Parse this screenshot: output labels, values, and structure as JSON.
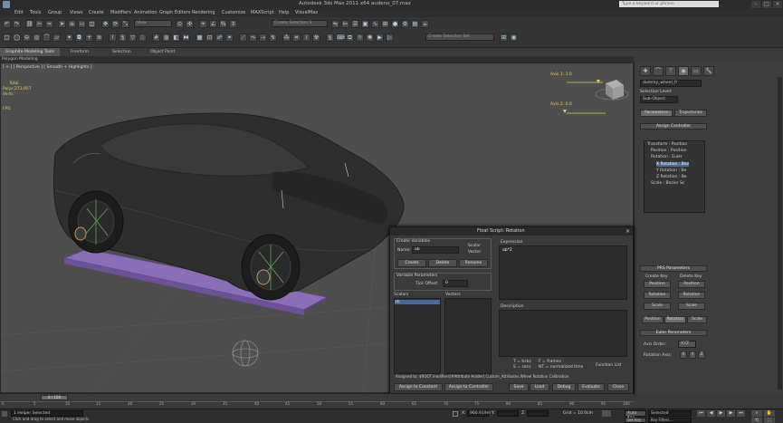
{
  "app": {
    "title": "Autodesk 3ds Max 2011 x64    audeno_07.max",
    "search_placeholder": "Type a keyword or phrase"
  },
  "menu": [
    "Edit",
    "Tools",
    "Group",
    "Views",
    "Create",
    "Modifiers",
    "Animation",
    "Graph Editors",
    "Rendering",
    "Customize",
    "MAXScript",
    "Help",
    "VisualMax"
  ],
  "toolbar": {
    "selection_filter": "Create Selection S",
    "named_selection": "Create Selection Set",
    "view_dropdown": "View"
  },
  "ribbon": {
    "tabs": [
      "Graphite Modeling Tools",
      "Freeform",
      "Selection",
      "Object Paint"
    ],
    "sub_label": "Polygon Modeling"
  },
  "viewport": {
    "label": "[ + ] [ Perspective ] [ Smooth + Highlights ]",
    "stats_header": "Total",
    "polys_label": "Polys:",
    "polys_value": "273,957",
    "verts_label": "Verts:",
    "verts_value": "",
    "fps_label": "FPS:",
    "fps_value": "",
    "axis_top_label": "Axis 1: 1.0",
    "axis_bottom_label": "Axis 2: 0.0"
  },
  "command_panel": {
    "object_name": "dummy_wheel_fr",
    "selection_level_label": "Selection Level:",
    "selection_level_value": "Sub-Object",
    "tab_parameters": "Parameters",
    "tab_trajectories": "Trajectories",
    "assign_controller_rollout": "Assign Controller",
    "tree": [
      "Transform : Position",
      "Position : Position",
      "Rotation : Euler",
      "X Rotation : Bez",
      "Y Rotation : Be",
      "Z Rotation : Be",
      "Scale : Bezier Sc"
    ],
    "pri_rollout": "PRS Parameters",
    "create_key_label": "Create Key",
    "delete_key_label": "Delete Key",
    "btn_position": "Position",
    "btn_rotation": "Rotation",
    "btn_scale": "Scale",
    "tab_position": "Position",
    "tab_rotation": "Rotation",
    "tab_scale": "Scale",
    "euler_rollout": "Euler Parameters",
    "axis_order_label": "Axis Order:",
    "axis_order_value": "XYZ",
    "rotation_axis_label": "Rotation Axis:"
  },
  "dialog": {
    "title": "Float Script: Rotation",
    "create_variables_label": "Create Variables",
    "name_label": "Name:",
    "name_value": "ab",
    "scalar_label": "Scalar",
    "vector_label": "Vector",
    "btn_create": "Create",
    "btn_delete": "Delete",
    "btn_rename": "Rename",
    "variable_params_label": "Variable Parameters",
    "tick_offset_label": "Tick Offset:",
    "tick_offset_value": "0",
    "scalars_label": "Scalars",
    "scalar_item": "ab",
    "vectors_label": "Vectors",
    "expression_label": "Expression",
    "expression_value": "ab*2",
    "description_label": "Description",
    "legend_t": "T = ticks",
    "legend_f": "F = frames",
    "legend_s": "S = secs",
    "legend_nt": "NT = normalized time",
    "function_list": "Function List",
    "assigned_to_label": "Assigned to: $ROOT.modifiers[#Attribute Holder].Custom_Attributes.Wheel Rotation Calibration",
    "btn_assign_constant": "Assign to Constant",
    "btn_assign_controller": "Assign to Controller",
    "btn_save": "Save",
    "btn_load": "Load",
    "btn_debug": "Debug",
    "btn_evaluate": "Evaluate",
    "btn_close": "Close"
  },
  "timeline": {
    "frame_counter": "0 / 100",
    "ticks": [
      "0",
      "5",
      "10",
      "15",
      "20",
      "25",
      "30",
      "35",
      "40",
      "45",
      "50",
      "55",
      "60",
      "65",
      "70",
      "75",
      "80",
      "85",
      "90",
      "95",
      "100"
    ]
  },
  "status": {
    "selection_text": "1 Helper Selected",
    "prompt_text": "Click and drag to select and move objects",
    "x_label": "X:",
    "x_value": "960.919m",
    "y_label": "Y:",
    "y_value": "",
    "z_label": "Z:",
    "z_value": "",
    "grid_label": "Grid = 10.0cm",
    "auto_key_label": "Auto Key",
    "selected_label": "Selected",
    "set_key_label": "Set Key",
    "key_filters_label": "Key Filters..."
  },
  "colors": {
    "viewport_bg": "#4e4e4e",
    "car_body": "#2e2e2e",
    "platform": "#8a6fb8",
    "highlight_select": "#4a6a9a",
    "stats_text": "#e0d060"
  }
}
